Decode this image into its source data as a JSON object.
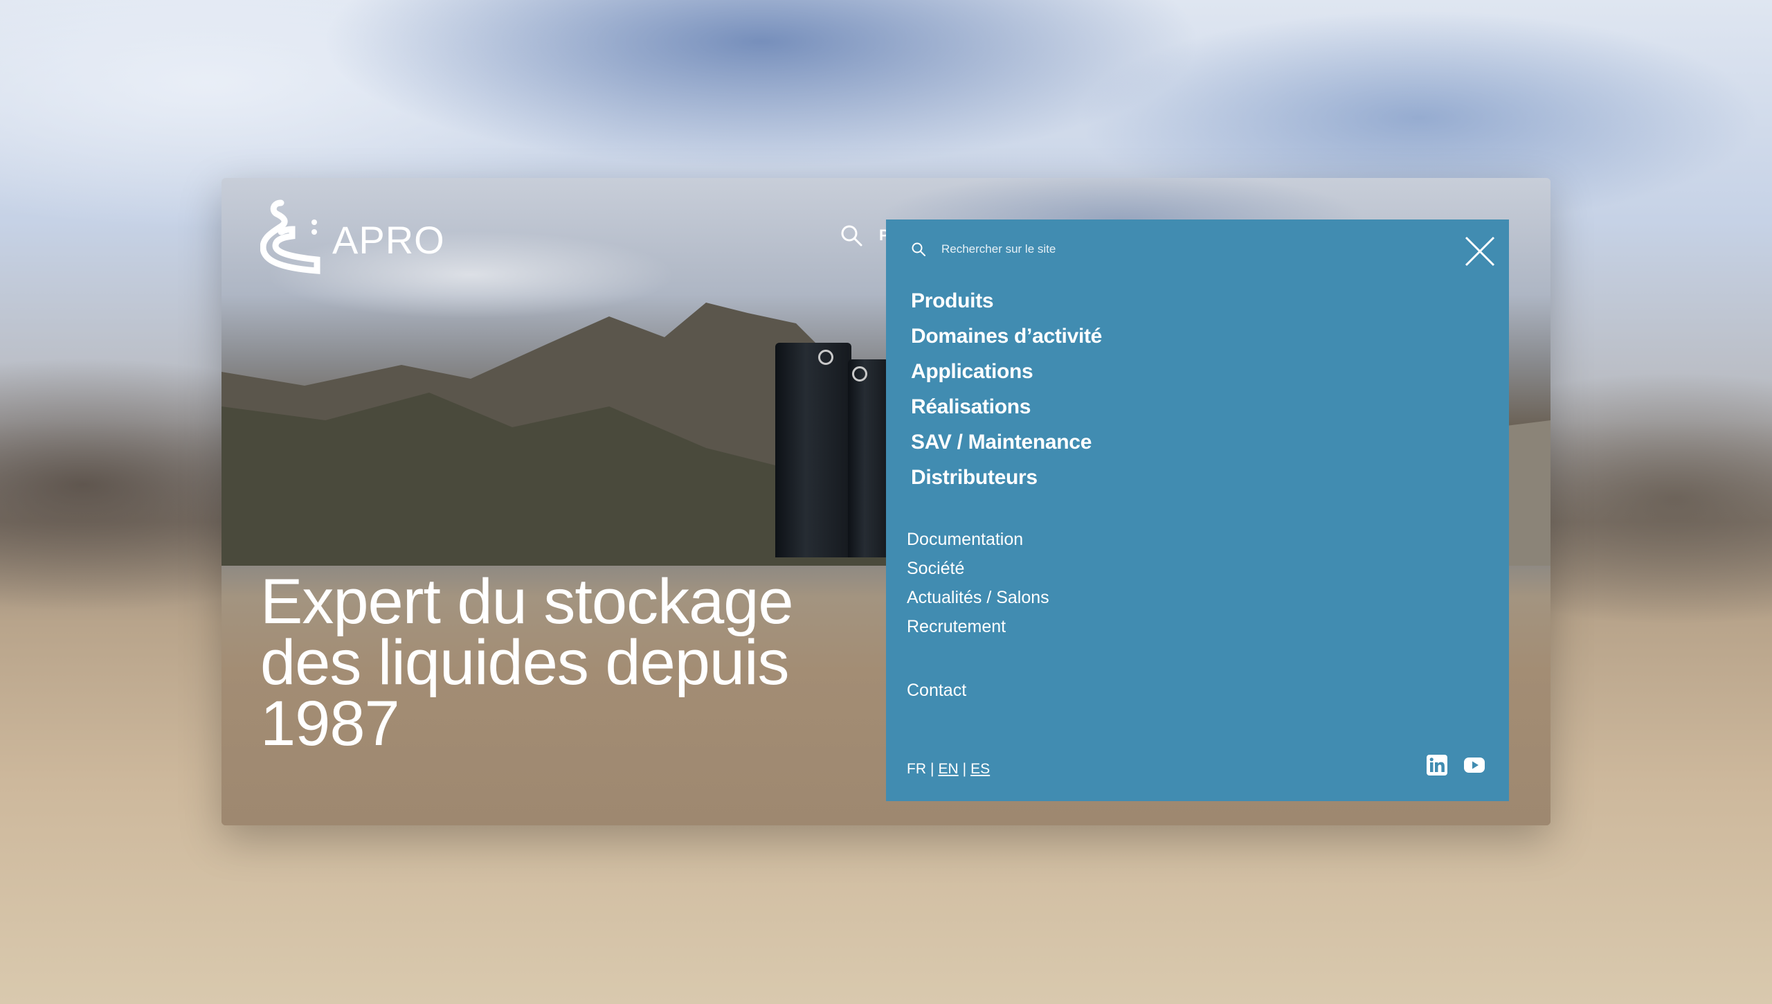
{
  "site": {
    "logo_text": "APRO"
  },
  "hero": {
    "title": "Expert du stockage des liquides depuis 1987",
    "header_peek": "P"
  },
  "menu": {
    "search_placeholder": "Rechercher sur le site",
    "primary_items": [
      "Produits",
      "Domaines d’activité",
      "Applications",
      "Réalisations",
      "SAV / Maintenance",
      "Distributeurs"
    ],
    "secondary_items": [
      "Documentation",
      "Société",
      "Actualités / Salons",
      "Recrutement"
    ],
    "contact_label": "Contact",
    "languages": {
      "current": "FR",
      "separator": "|",
      "others": [
        "EN",
        "ES"
      ]
    },
    "social_icons": [
      "linkedin-icon",
      "youtube-icon"
    ]
  },
  "colors": {
    "panel_bg": "#418cb1",
    "text": "#ffffff"
  }
}
